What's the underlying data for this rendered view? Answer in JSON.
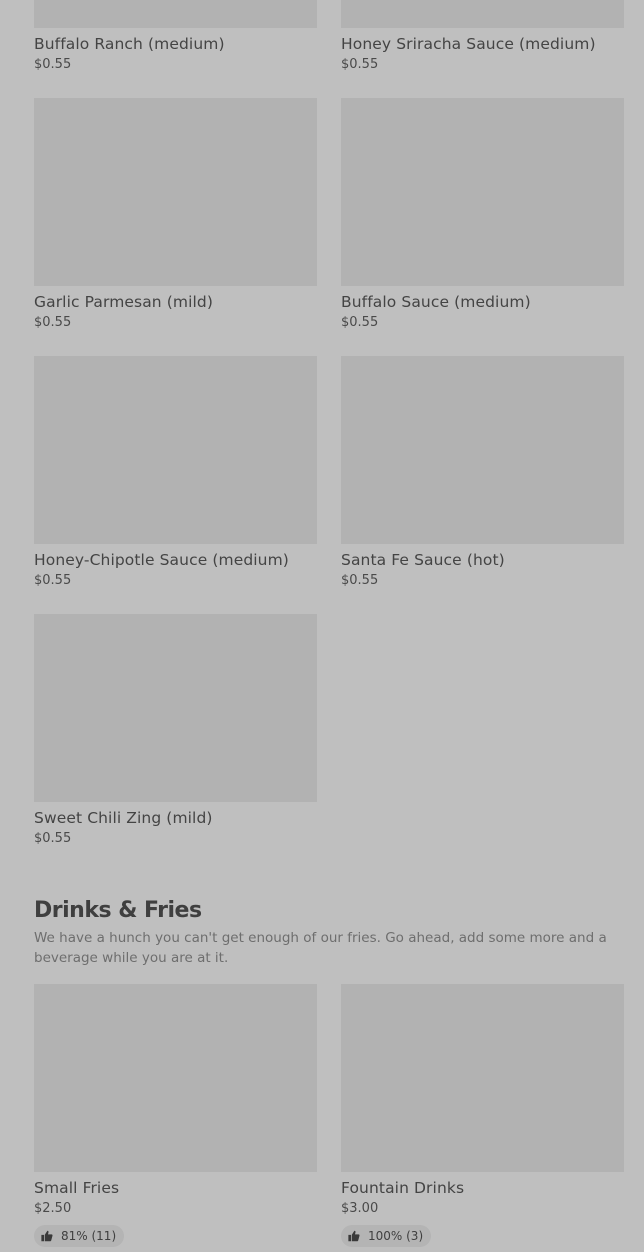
{
  "sauces": {
    "items": [
      {
        "name": "Buffalo Ranch (medium)",
        "price": "$0.55"
      },
      {
        "name": "Honey Sriracha Sauce (medium)",
        "price": "$0.55"
      },
      {
        "name": "Garlic Parmesan (mild)",
        "price": "$0.55"
      },
      {
        "name": "Buffalo Sauce (medium)",
        "price": "$0.55"
      },
      {
        "name": "Honey-Chipotle Sauce (medium)",
        "price": "$0.55"
      },
      {
        "name": "Santa Fe Sauce (hot)",
        "price": "$0.55"
      },
      {
        "name": "Sweet Chili Zing (mild)",
        "price": "$0.55"
      }
    ]
  },
  "drinks_fries": {
    "title": "Drinks & Fries",
    "description": "We have a hunch you can't get enough of our fries. Go ahead, add some more and a beverage while you are at it.",
    "items": [
      {
        "name": "Small Fries",
        "price": "$2.50",
        "rating": "81% (11)",
        "rating_icon": "thumbs-up-icon"
      },
      {
        "name": "Fountain Drinks",
        "price": "$3.00",
        "rating": "100% (3)",
        "rating_icon": "thumbs-up-icon"
      }
    ]
  },
  "colors": {
    "page_background": "#bfbfbf",
    "image_placeholder": "#b2b2b2",
    "badge_background": "#b4b4b4"
  }
}
